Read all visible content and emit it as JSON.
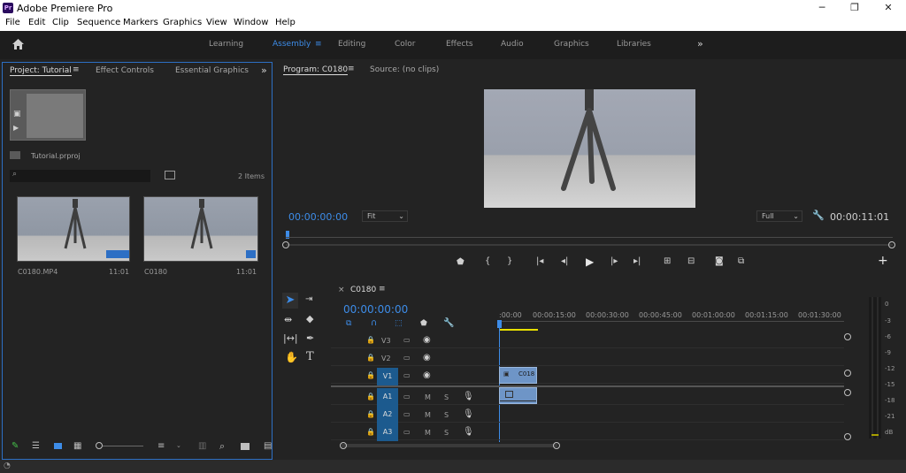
{
  "window": {
    "title": "Adobe Premiere Pro",
    "logo": "Pr",
    "minimize": "─",
    "restore": "❐",
    "close": "✕"
  },
  "menu": [
    "File",
    "Edit",
    "Clip",
    "Sequence",
    "Markers",
    "Graphics",
    "View",
    "Window",
    "Help"
  ],
  "workspaces": {
    "home_icon": "home-icon",
    "items": [
      "Learning",
      "Assembly",
      "Editing",
      "Color",
      "Effects",
      "Audio",
      "Graphics",
      "Libraries"
    ],
    "active": "Assembly",
    "more": "»",
    "menu_glyph": "≡"
  },
  "project": {
    "tabs": [
      "Project: Tutorial",
      "Effect Controls",
      "Essential Graphics"
    ],
    "more": "»",
    "file_name": "Tutorial.prproj",
    "search_placeholder": "",
    "items_count": "2 Items",
    "clips": [
      {
        "name": "C0180.MP4",
        "duration": "11:01"
      },
      {
        "name": "C0180",
        "duration": "11:01"
      }
    ]
  },
  "program": {
    "tabs": [
      "Program: C0180",
      "Source: (no clips)"
    ],
    "timecode": "00:00:00:00",
    "fit": "Fit",
    "quality": "Full",
    "duration": "00:00:11:01",
    "transport": [
      "marker-icon",
      "mark-in-icon",
      "mark-out-icon",
      "go-to-in-icon",
      "step-back-icon",
      "play-icon",
      "step-forward-icon",
      "go-to-out-icon",
      "lift-icon",
      "extract-icon",
      "export-frame-icon",
      "compare-icon"
    ],
    "add": "+"
  },
  "timeline": {
    "tab": "C0180",
    "close": "×",
    "timecode": "00:00:00:00",
    "ruler": [
      ":00:00",
      "00:00:15:00",
      "00:00:30:00",
      "00:00:45:00",
      "00:01:00:00",
      "00:01:15:00",
      "00:01:30:00"
    ],
    "video_tracks": [
      "V3",
      "V2",
      "V1"
    ],
    "audio_tracks": [
      "A1",
      "A2",
      "A3"
    ],
    "clip_label": "C018",
    "m": "M",
    "s": "S"
  },
  "meters": {
    "scale": [
      "0",
      "-3",
      "-6",
      "-9",
      "-12",
      "-15",
      "-18",
      "-21",
      "dB"
    ]
  },
  "colors": {
    "accent": "#3d8ce8",
    "track_active": "#1c5a8e",
    "clip": "#6e95c7"
  }
}
